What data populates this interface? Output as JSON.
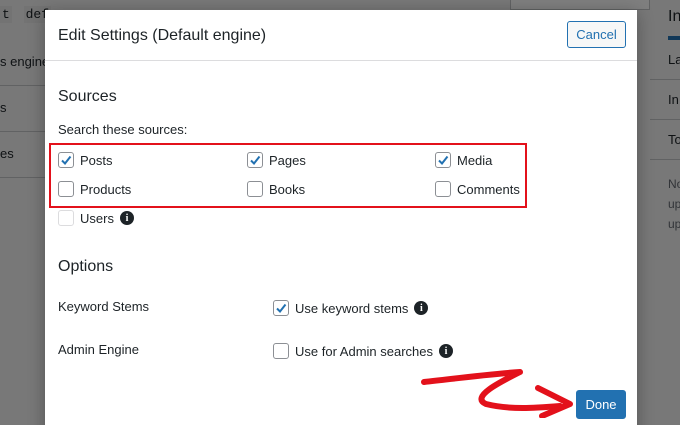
{
  "background": {
    "code_snippets": [
      "t",
      "def"
    ],
    "left_rows": [
      "s engine",
      "s",
      "es"
    ],
    "right_title": "In",
    "right_rows": [
      "La",
      "In",
      "To"
    ],
    "right_note": [
      "No",
      "up",
      "up"
    ]
  },
  "modal": {
    "title": "Edit Settings (Default engine)",
    "cancel_label": "Cancel",
    "sources": {
      "heading": "Sources",
      "help": "Search these sources:",
      "items": [
        {
          "label": "Posts",
          "checked": true
        },
        {
          "label": "Pages",
          "checked": true
        },
        {
          "label": "Media",
          "checked": true
        },
        {
          "label": "Products",
          "checked": false
        },
        {
          "label": "Books",
          "checked": false
        },
        {
          "label": "Comments",
          "checked": false
        }
      ],
      "users_label": "Users"
    },
    "options": {
      "heading": "Options",
      "keyword_stems_label": "Keyword Stems",
      "keyword_stems_checkbox": "Use keyword stems",
      "admin_engine_label": "Admin Engine",
      "admin_engine_checkbox": "Use for Admin searches"
    },
    "done_label": "Done"
  },
  "colors": {
    "accent": "#2271b1",
    "highlight": "#e3111b"
  }
}
